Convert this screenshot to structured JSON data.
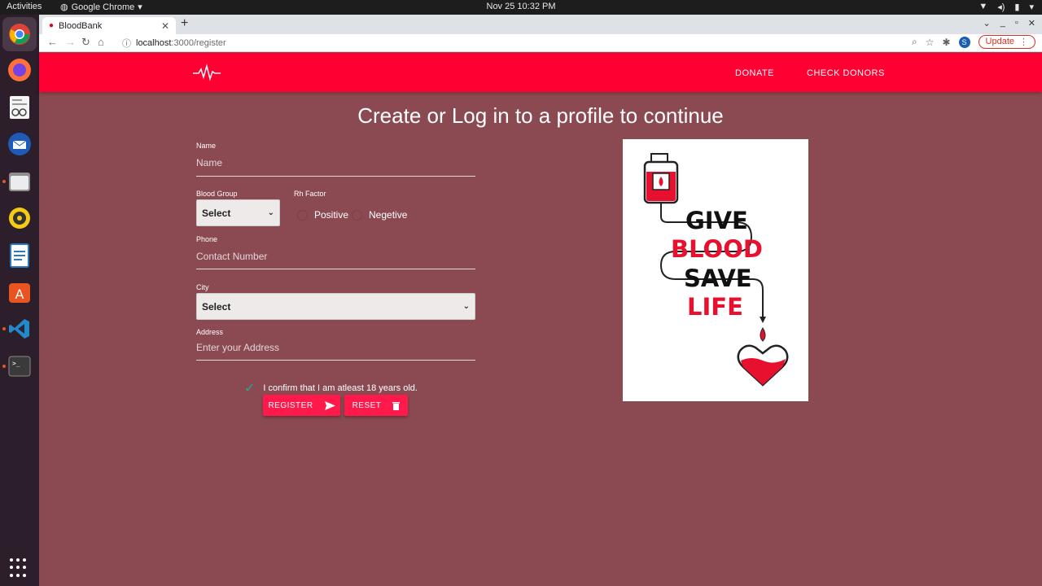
{
  "system": {
    "activities": "Activities",
    "app_menu": "Google Chrome",
    "clock": "Nov 25  10:32 PM"
  },
  "browser": {
    "tab_title": "BloodBank",
    "url_host": "localhost",
    "url_path": ":3000/register",
    "profile_initial": "S",
    "update_label": "Update"
  },
  "navbar": {
    "links": [
      "DONATE",
      "CHECK DONORS"
    ]
  },
  "main": {
    "heading": "Create or Log in to a profile to continue"
  },
  "form": {
    "name_label": "Name",
    "name_placeholder": "Name",
    "blood_group_label": "Blood Group",
    "blood_group_value": "Select",
    "rh_label": "Rh Factor",
    "rh_options": [
      "Positive",
      "Negetive"
    ],
    "phone_label": "Phone",
    "phone_placeholder": "Contact Number",
    "city_label": "City",
    "city_value": "Select",
    "address_label": "Address",
    "address_placeholder": "Enter your Address",
    "confirm_text": "I confirm that I am atleast 18 years old.",
    "register_label": "REGISTER",
    "reset_label": "RESET"
  },
  "poster": {
    "lines": [
      "GIVE",
      "BLOOD",
      "SAVE",
      "LIFE"
    ]
  },
  "colors": {
    "navbar": "#ff0033",
    "background": "#8b4a51",
    "button": "#ff1a4b",
    "check": "#26a69a"
  }
}
